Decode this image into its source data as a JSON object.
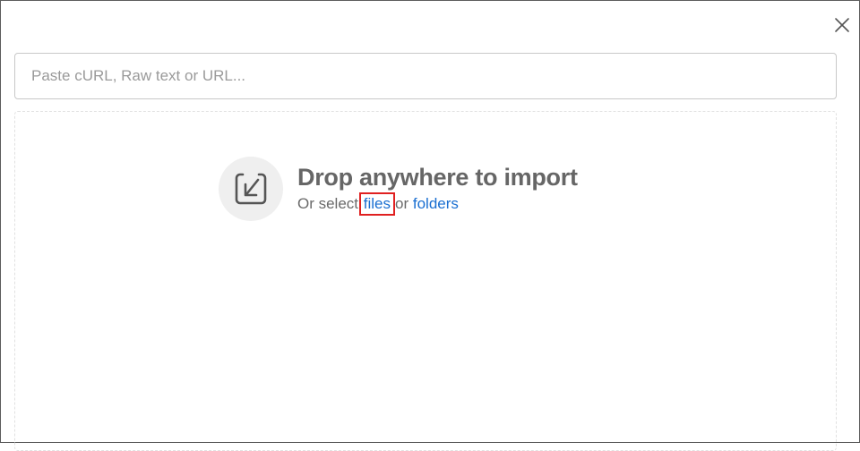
{
  "dialog": {
    "close_icon": "close-icon"
  },
  "search": {
    "placeholder": "Paste cURL, Raw text or URL...",
    "value": ""
  },
  "dropzone": {
    "icon": "import-icon",
    "title": "Drop anywhere to import",
    "subtitle_prefix": "Or select",
    "files_link": "files",
    "subtitle_middle": "or",
    "folders_link": "folders"
  },
  "colors": {
    "link": "#1a6fd1",
    "highlight": "#e02020",
    "title": "#666666"
  }
}
